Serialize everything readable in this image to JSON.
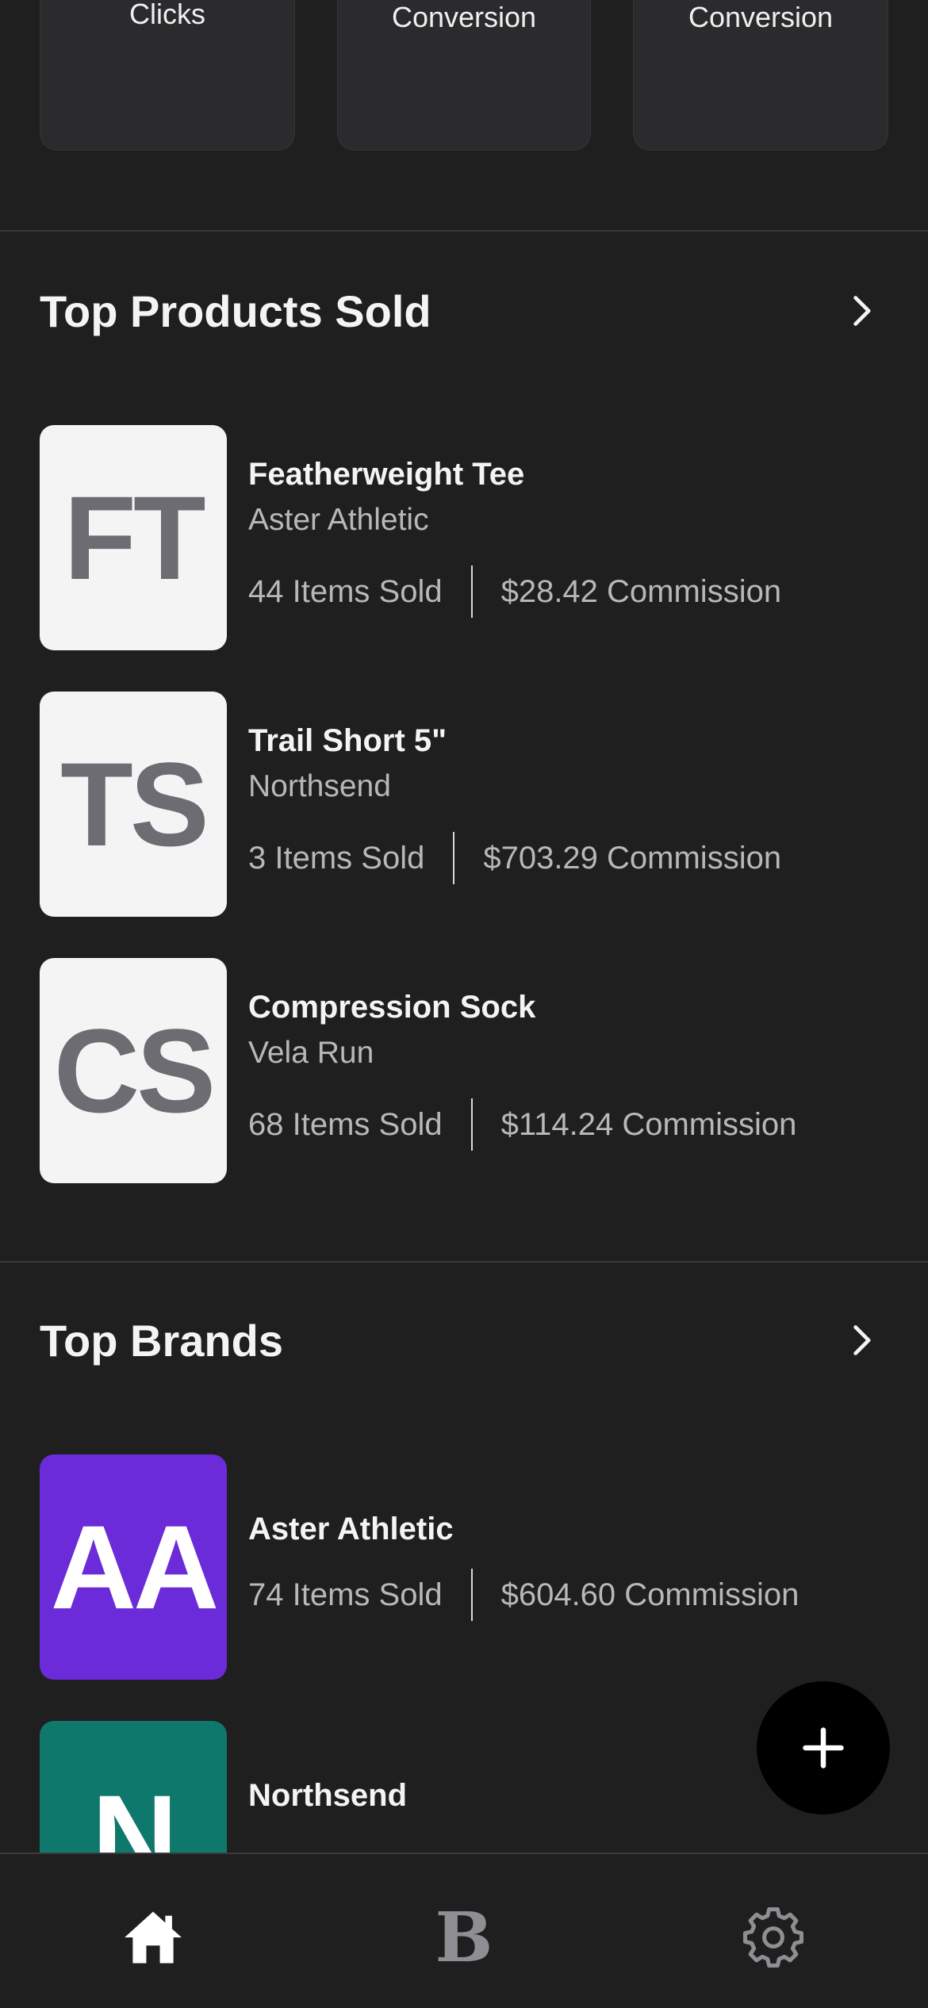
{
  "metrics": [
    {
      "label": "Clicks"
    },
    {
      "label": "Conversion"
    },
    {
      "label": "Conversion"
    }
  ],
  "top_products": {
    "title": "Top Products Sold",
    "items": [
      {
        "initials": "FT",
        "name": "Featherweight Tee",
        "brand": "Aster Athletic",
        "items_sold": "44 Items Sold",
        "commission": "$28.42 Commission"
      },
      {
        "initials": "TS",
        "name": "Trail Short 5\"",
        "brand": "Northsend",
        "items_sold": "3 Items Sold",
        "commission": "$703.29 Commission"
      },
      {
        "initials": "CS",
        "name": "Compression Sock",
        "brand": "Vela Run",
        "items_sold": "68 Items Sold",
        "commission": "$114.24 Commission"
      }
    ]
  },
  "top_brands": {
    "title": "Top Brands",
    "items": [
      {
        "initials": "AA",
        "name": "Aster Athletic",
        "items_sold": "74 Items Sold",
        "commission": "$604.60 Commission",
        "color": "#6b2bd9"
      },
      {
        "initials": "N",
        "name": "Northsend",
        "items_sold": "",
        "commission": "",
        "color": "#0f786c"
      }
    ]
  },
  "fab": {
    "icon": "plus-icon"
  },
  "bottom_nav": {
    "items": [
      {
        "icon": "home-icon",
        "active": true
      },
      {
        "icon": "brand-b-icon",
        "glyph": "B",
        "active": false
      },
      {
        "icon": "gear-icon",
        "active": false
      }
    ]
  },
  "colors": {
    "background": "#1f1f20",
    "card": "#2b2b2d",
    "text_primary": "#f4f4f4",
    "text_secondary": "#b8b8ba",
    "thumb_bg": "#f4f4f4",
    "thumb_text": "#6c6c72"
  }
}
